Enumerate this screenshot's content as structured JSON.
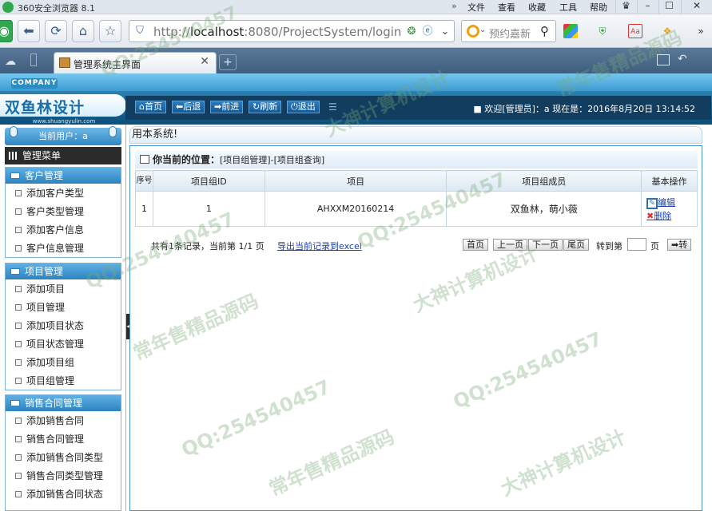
{
  "browser": {
    "title": "360安全浏览器 8.1",
    "menu": [
      "文件",
      "查看",
      "收藏",
      "工具",
      "帮助"
    ],
    "window_buttons": [
      "♛",
      "–",
      "☐",
      "✕"
    ],
    "url_host": "localhost",
    "url_rest": ":8080/ProjectSystem/login",
    "url_prefix": "http://",
    "search_placeholder": "预约嘉新",
    "tab_title": "管理系统主界面",
    "tab_close": "✕",
    "new_tab": "+"
  },
  "header": {
    "company_badge": "COMPANY",
    "logo_text": "双鱼林设计",
    "logo_url": "www.shuangyulin.com",
    "toolbar": [
      "首页",
      "后退",
      "前进",
      "刷新",
      "退出"
    ],
    "welcome": "■ 欢迎[管理员]：a 现在是：2016年8月20日 13:14:52"
  },
  "sidebar": {
    "current_user": "当前用户：a",
    "menu_title": "管理菜单",
    "groups": [
      {
        "title": "客户管理",
        "items": [
          "添加客户类型",
          "客户类型管理",
          "添加客户信息",
          "客户信息管理"
        ]
      },
      {
        "title": "项目管理",
        "items": [
          "添加项目",
          "项目管理",
          "添加项目状态",
          "项目状态管理",
          "添加项目组",
          "项目组管理"
        ]
      },
      {
        "title": "销售合同管理",
        "items": [
          "添加销售合同",
          "销售合同管理",
          "添加销售合同类型",
          "销售合同类型管理",
          "添加销售合同状态"
        ]
      }
    ]
  },
  "main": {
    "marquee": "用本系统!",
    "position_label": "你当前的位置：",
    "position_path": "[项目组管理]-[项目组查询]",
    "table": {
      "headers": [
        "序号",
        "项目组ID",
        "项目",
        "项目组成员",
        "基本操作"
      ],
      "rows": [
        {
          "seq": "1",
          "id": "1",
          "project": "AHXXM20160214",
          "members": "双鱼林，萌小薇",
          "edit": "编辑",
          "delete": "删除"
        }
      ]
    },
    "pager": {
      "info": "共有1条记录，当前第 1/1 页",
      "export": "导出当前记录到excel",
      "buttons": [
        "首页",
        "上一页",
        "下一页",
        "尾页"
      ],
      "goto_label": "转到第",
      "page_label": "页",
      "go_button": "➡转"
    }
  },
  "watermarks": [
    "QQ:254540457",
    "大神计算机设计",
    "常年售精品源码",
    "QQ:254540457",
    "大神计算机设计",
    "QQ:254540457",
    "常年售精品源码",
    "QQ:254540457",
    "大神计算机设计",
    "常年售精品源码",
    "QQ:254540457"
  ]
}
